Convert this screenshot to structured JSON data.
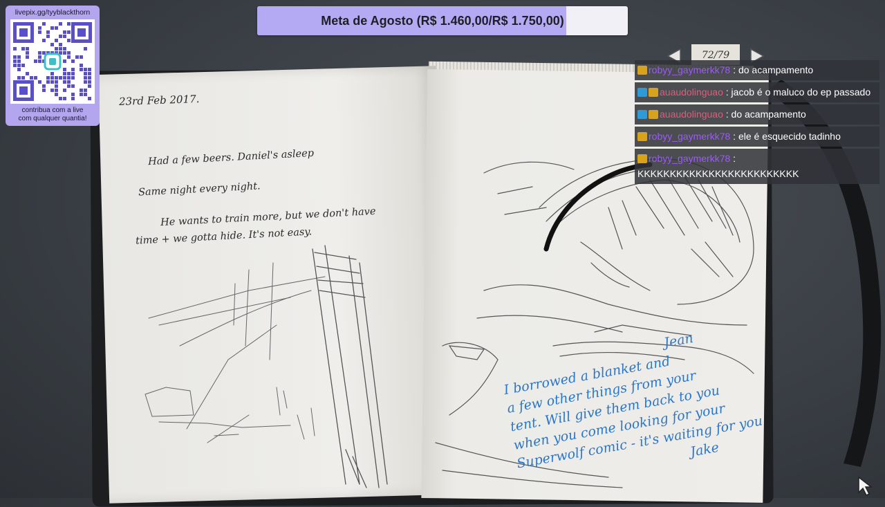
{
  "goal": {
    "label": "Meta de Agosto (R$ 1.460,00/R$ 1.750,00)",
    "progress": 0.834,
    "fill_color": "#b4aaf4"
  },
  "qr_card": {
    "url": "livepix.gg/tyyblackthorn",
    "caption_line1": "contribua com a live",
    "caption_line2": "com qualquer quantia!",
    "icon": "qr-code-icon"
  },
  "notebook": {
    "page_counter": "72/79",
    "prev_icon": "arrow-left-icon",
    "next_icon": "arrow-right-icon",
    "date": "23rd Feb 2017.",
    "journal": [
      "Had a few beers. Daniel's asleep",
      "Same night every night.",
      "He wants to train more, but we don't have",
      "time + we gotta hide. It's not easy."
    ],
    "blue_note": [
      "Jean",
      "I borrowed a blanket and",
      "a few other things from your",
      "tent. Will give them back to you",
      "when you come looking for your",
      "Superwolf comic - it's waiting for you",
      "Jake"
    ]
  },
  "chat": {
    "messages": [
      {
        "badges": [
          "crown"
        ],
        "user": "robyy_gaymerkk78",
        "user_color": "#9b5cf6",
        "text": "do acampamento"
      },
      {
        "badges": [
          "mod",
          "crown"
        ],
        "user": "auaudolinguao",
        "user_color": "#e05c7a",
        "text": "jacob é o maluco do ep passado"
      },
      {
        "badges": [
          "mod",
          "crown"
        ],
        "user": "auaudolinguao",
        "user_color": "#e05c7a",
        "text": "do acampamento"
      },
      {
        "badges": [
          "crown"
        ],
        "user": "robyy_gaymerkk78",
        "user_color": "#9b5cf6",
        "text": "ele é esquecido tadinho"
      },
      {
        "badges": [
          "crown"
        ],
        "user": "robyy_gaymerkk78",
        "user_color": "#9b5cf6",
        "text": "KKKKKKKKKKKKKKKKKKKKKKKKK"
      }
    ]
  }
}
